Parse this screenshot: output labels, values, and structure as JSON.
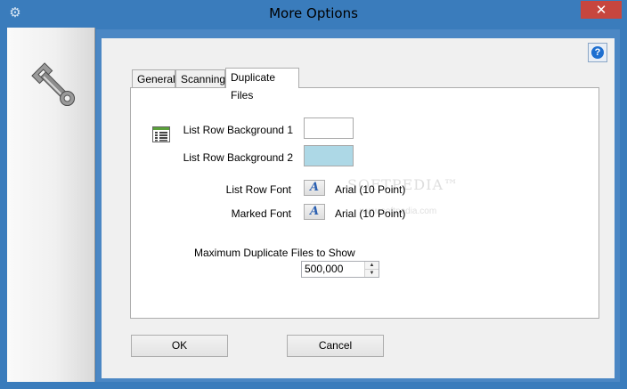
{
  "window": {
    "title": "More Options",
    "close_glyph": "✕",
    "app_icon": "gear-icon"
  },
  "sidebar": {
    "icon": "wrench-icon"
  },
  "help": {
    "glyph": "?",
    "icon": "help-icon"
  },
  "tabs": [
    {
      "label": "General",
      "active": false
    },
    {
      "label": "Scanning",
      "active": false
    },
    {
      "label": "Duplicate Files",
      "active": true
    }
  ],
  "duplicate_files": {
    "list_icon": "list-grid-icon",
    "row_bg1_label": "List Row Background 1",
    "row_bg1_color": "#ffffff",
    "row_bg2_label": "List Row Background 2",
    "row_bg2_color": "#add8e6",
    "row_font_label": "List Row Font",
    "row_font_value": "Arial (10 Point)",
    "marked_font_label": "Marked Font",
    "marked_font_value": "Arial (10 Point)",
    "font_button_glyph": "A",
    "max_label": "Maximum Duplicate Files to Show",
    "max_value": "500,000"
  },
  "buttons": {
    "ok": "OK",
    "cancel": "Cancel"
  },
  "colors": {
    "titlebar": "#3a7cbc",
    "close": "#c7463e",
    "panel": "#4b87c4"
  }
}
